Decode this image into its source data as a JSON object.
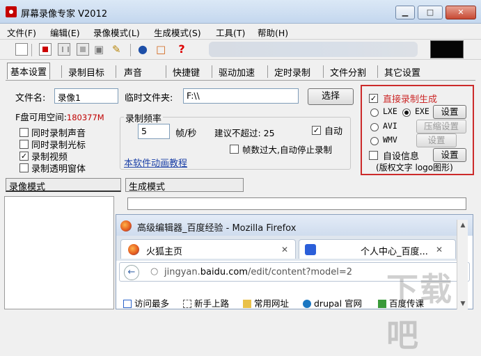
{
  "window": {
    "title": "屏幕录像专家 V2012",
    "minimize": "▁",
    "maximize": "□",
    "close": "✕"
  },
  "menu": [
    "文件(F)",
    "编辑(E)",
    "录像模式(L)",
    "生成模式(S)",
    "工具(T)",
    "帮助(H)"
  ],
  "toolbar": {
    "icons": [
      "new-file-icon",
      "record-icon",
      "pause-icon",
      "stop-icon",
      "camera-icon",
      "brush-icon",
      "globe-icon",
      "clipboard-icon",
      "help-icon"
    ],
    "help_glyph": "?"
  },
  "tabs": [
    "基本设置",
    "录制目标",
    "声音",
    "快捷键",
    "驱动加速",
    "定时录制",
    "文件分割",
    "其它设置"
  ],
  "basic": {
    "filename_label": "文件名:",
    "filename_value": "录像1",
    "tempfolder_label": "临时文件夹:",
    "tempfolder_value": "F:\\\\",
    "choose_button": "选择",
    "disk_label": "F盘可用空间:",
    "disk_value": "180377M",
    "options": [
      {
        "label": "同时录制声音",
        "checked": false
      },
      {
        "label": "同时录制光标",
        "checked": false
      },
      {
        "label": "录制视频",
        "checked": true
      },
      {
        "label": "录制透明窗体",
        "checked": false
      }
    ],
    "freq": {
      "group_label": "录制频率",
      "value": "5",
      "unit": "帧/秒",
      "suggest": "建议不超过: 25",
      "auto_label": "自动",
      "auto_checked": true,
      "autostop_label": "帧数过大,自动停止录制",
      "autostop_checked": false
    },
    "tutorial_link": "本软件动画教程"
  },
  "direct": {
    "direct_label": "直接录制生成",
    "direct_checked": true,
    "formats": [
      {
        "label": "LXE",
        "selected": false,
        "button": "",
        "button_enabled": false
      },
      {
        "label": "EXE",
        "selected": true,
        "button": "设置",
        "button_enabled": true
      },
      {
        "label": "AVI",
        "selected": false,
        "button": "压缩设置",
        "button_enabled": false
      },
      {
        "label": "WMV",
        "selected": false,
        "button": "设置",
        "button_enabled": false
      }
    ],
    "self_info_label": "自设信息",
    "self_info_checked": false,
    "self_info_button": "设置",
    "copyright_note": "(版权文字 logo图形)"
  },
  "modes": {
    "record_mode": "录像模式",
    "gen_mode": "生成模式"
  },
  "firefox": {
    "title": "高级编辑器_百度经验 - Mozilla Firefox",
    "tabs": [
      {
        "label": "火狐主页",
        "close": "✕"
      },
      {
        "label": "个人中心_百度...",
        "close": "✕"
      }
    ],
    "url_domain": "jingyan.",
    "url_bold": "baidu.com",
    "url_path": "/edit/content?model=2",
    "bookmarks": [
      "访问最多",
      "新手上路",
      "常用网址",
      "drupal 官网",
      "百度传课"
    ],
    "scroll_up": "▲",
    "scroll_down": "▼"
  },
  "watermark": "下载吧",
  "colors": {
    "accent_red": "#cc2a2a",
    "link_blue": "#1a3fa6",
    "disk_red": "#c00000"
  }
}
